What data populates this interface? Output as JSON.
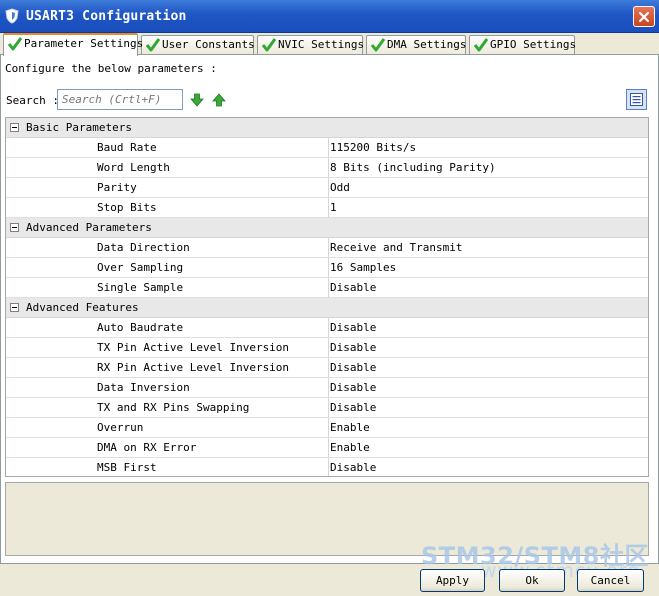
{
  "window": {
    "title": "USART3 Configuration"
  },
  "tabs": [
    {
      "label": "Parameter Settings"
    },
    {
      "label": "User Constants"
    },
    {
      "label": "NVIC Settings"
    },
    {
      "label": "DMA Settings"
    },
    {
      "label": "GPIO Settings"
    }
  ],
  "intro": "Configure the below parameters :",
  "search": {
    "label": "Search :",
    "placeholder": "Search (Crtl+F)"
  },
  "groups": [
    {
      "label": "Basic Parameters",
      "rows": [
        {
          "name": "Baud Rate",
          "value": "115200 Bits/s"
        },
        {
          "name": "Word Length",
          "value": "8 Bits (including Parity)"
        },
        {
          "name": "Parity",
          "value": "Odd"
        },
        {
          "name": "Stop Bits",
          "value": "1"
        }
      ]
    },
    {
      "label": "Advanced Parameters",
      "rows": [
        {
          "name": "Data Direction",
          "value": "Receive and Transmit"
        },
        {
          "name": "Over Sampling",
          "value": "16 Samples"
        },
        {
          "name": "Single Sample",
          "value": "Disable"
        }
      ]
    },
    {
      "label": "Advanced Features",
      "rows": [
        {
          "name": "Auto Baudrate",
          "value": "Disable"
        },
        {
          "name": "TX Pin Active Level Inversion",
          "value": "Disable"
        },
        {
          "name": "RX Pin Active Level Inversion",
          "value": "Disable"
        },
        {
          "name": "Data Inversion",
          "value": "Disable"
        },
        {
          "name": "TX and RX Pins Swapping",
          "value": "Disable"
        },
        {
          "name": "Overrun",
          "value": "Enable"
        },
        {
          "name": "DMA on RX Error",
          "value": "Enable"
        },
        {
          "name": "MSB First",
          "value": "Disable"
        }
      ]
    }
  ],
  "watermark": {
    "line1": "STM32/STM8社区",
    "line2": "www.stmcu.org"
  },
  "buttons": {
    "apply": "Apply",
    "ok": "Ok",
    "cancel": "Cancel"
  },
  "colors": {
    "title_bar": "#1f55c4",
    "check_green": "#2eaa2e",
    "tab_active_accent": "#e68b2c"
  }
}
